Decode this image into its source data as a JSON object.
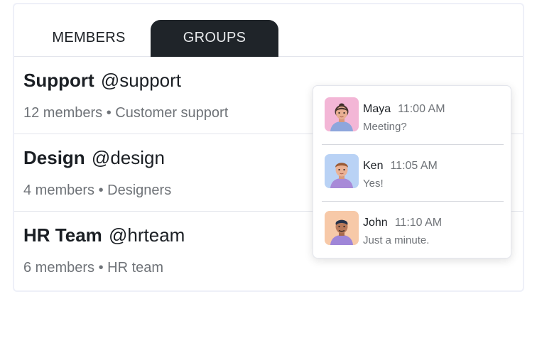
{
  "tabs": {
    "members": "MEMBERS",
    "groups": "GROUPS",
    "active": "groups"
  },
  "groups": [
    {
      "name": "Support",
      "handle": "@support",
      "members": "12 members",
      "separator": "•",
      "description": "Customer support"
    },
    {
      "name": "Design",
      "handle": "@design",
      "members": "4 members",
      "separator": "•",
      "description": "Designers"
    },
    {
      "name": "HR Team",
      "handle": "@hrteam",
      "members": "6 members",
      "separator": "•",
      "description": "HR team"
    }
  ],
  "messages": [
    {
      "sender": "Maya",
      "time": "11:00 AM",
      "text": "Meeting?",
      "avatar": "avatar-woman-icon",
      "avatar_bg": "#f3b6d6"
    },
    {
      "sender": "Ken",
      "time": "11:05 AM",
      "text": "Yes!",
      "avatar": "avatar-man-icon",
      "avatar_bg": "#b9d2f5"
    },
    {
      "sender": "John",
      "time": "11:10 AM",
      "text": "Just a minute.",
      "avatar": "avatar-man-icon",
      "avatar_bg": "#f7c9a8"
    }
  ],
  "colors": {
    "active_tab_bg": "#1f2429",
    "active_tab_text": "#e6e8ea",
    "primary_text": "#1b1f24",
    "secondary_text": "#6f7378",
    "divider": "#e3e5ec"
  }
}
